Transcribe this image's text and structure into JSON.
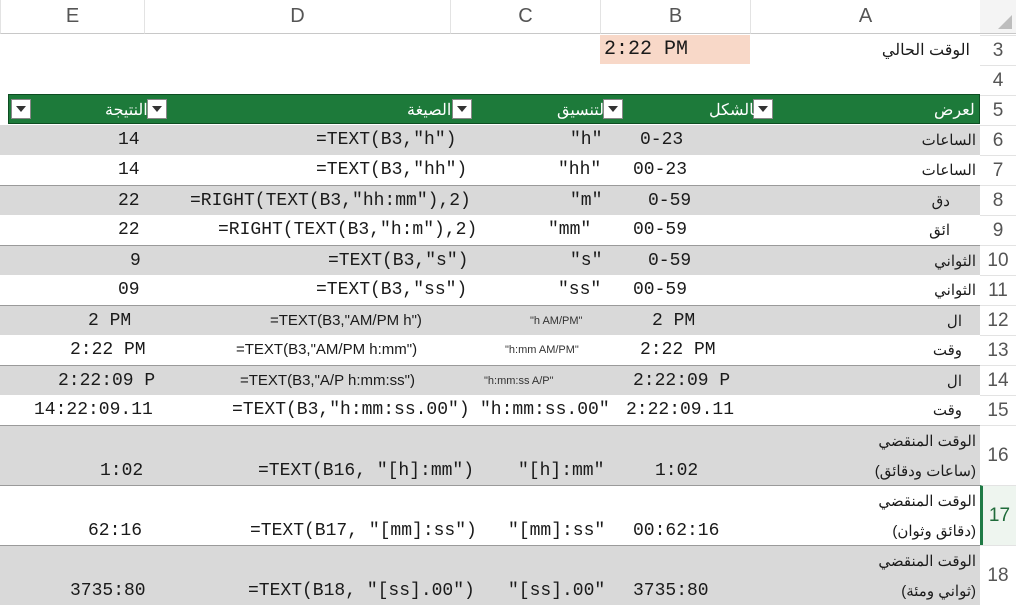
{
  "columns": [
    "A",
    "B",
    "C",
    "D",
    "E"
  ],
  "row_numbers": [
    "3",
    "4",
    "5",
    "6",
    "7",
    "8",
    "9",
    "10",
    "11",
    "12",
    "13",
    "14",
    "15",
    "16",
    "17",
    "18"
  ],
  "current_time": {
    "label": "الوقت الحالي",
    "value": "2:22 PM"
  },
  "table_headers": {
    "display": "لعرض",
    "as_shape": "بالشكل",
    "format": "التنسيق",
    "formula": "الصيغة",
    "result": "النتيجة"
  },
  "rows": [
    {
      "a": "الساعات",
      "b": "0-23",
      "c": "\"h\"",
      "d": "=TEXT(B3,\"h\")",
      "e": "14"
    },
    {
      "a": "الساعات",
      "b": "00-23",
      "c": "\"hh\"",
      "d": "=TEXT(B3,\"hh\")",
      "e": "14"
    },
    {
      "a": "دق",
      "b": "0-59",
      "c": "\"m\"",
      "d": "=RIGHT(TEXT(B3,\"hh:mm\"),2)",
      "e": "22"
    },
    {
      "a": "ائق",
      "b": "00-59",
      "c": "\"mm\"",
      "d": "=RIGHT(TEXT(B3,\"h:m\"),2)",
      "e": "22"
    },
    {
      "a": "الثواني",
      "b": "0-59",
      "c": "\"s\"",
      "d": "=TEXT(B3,\"s\")",
      "e": "9"
    },
    {
      "a": "الثواني",
      "b": "00-59",
      "c": "\"ss\"",
      "d": "=TEXT(B3,\"ss\")",
      "e": "09"
    },
    {
      "a": "ال",
      "b": "2 PM",
      "c": "\"h AM/PM\"",
      "d": "=TEXT(B3,\"AM/PM h\")",
      "e": "2 PM"
    },
    {
      "a": "وقت",
      "b": "2:22 PM",
      "c": "\"h:mm AM/PM\"",
      "d": "=TEXT(B3,\"AM/PM h:mm\")",
      "e": "2:22 PM"
    },
    {
      "a": "ال",
      "b": "2:22:09 P",
      "c": "\"h:mm:ss A/P\"",
      "d": "=TEXT(B3,\"A/P h:mm:ss\")",
      "e": "2:22:09 P"
    },
    {
      "a": "وقت",
      "b": "2:22:09.11",
      "c": "\"h:mm:ss.00\"",
      "d": "=TEXT(B3,\"h:mm:ss.00\")",
      "e": "14:22:09.11"
    }
  ],
  "elapsed_rows": [
    {
      "a1": "الوقت المنقضي",
      "a2": "(ساعات ودقائق)",
      "b": "1:02",
      "c": "\"[h]:mm\"",
      "d": "=TEXT(B16, \"[h]:mm\")",
      "e": "1:02"
    },
    {
      "a1": "الوقت المنقضي",
      "a2": "(دقائق وثوان)",
      "b": "00:62:16",
      "c": "\"[mm]:ss\"",
      "d": "=TEXT(B17, \"[mm]:ss\")",
      "e": "62:16"
    },
    {
      "a1": "الوقت المنقضي",
      "a2": "(ثواني ومئة)",
      "b": "3735:80",
      "c": "\"[ss].00\"",
      "d": "=TEXT(B18, \"[ss].00\")",
      "e": "3735:80"
    }
  ]
}
